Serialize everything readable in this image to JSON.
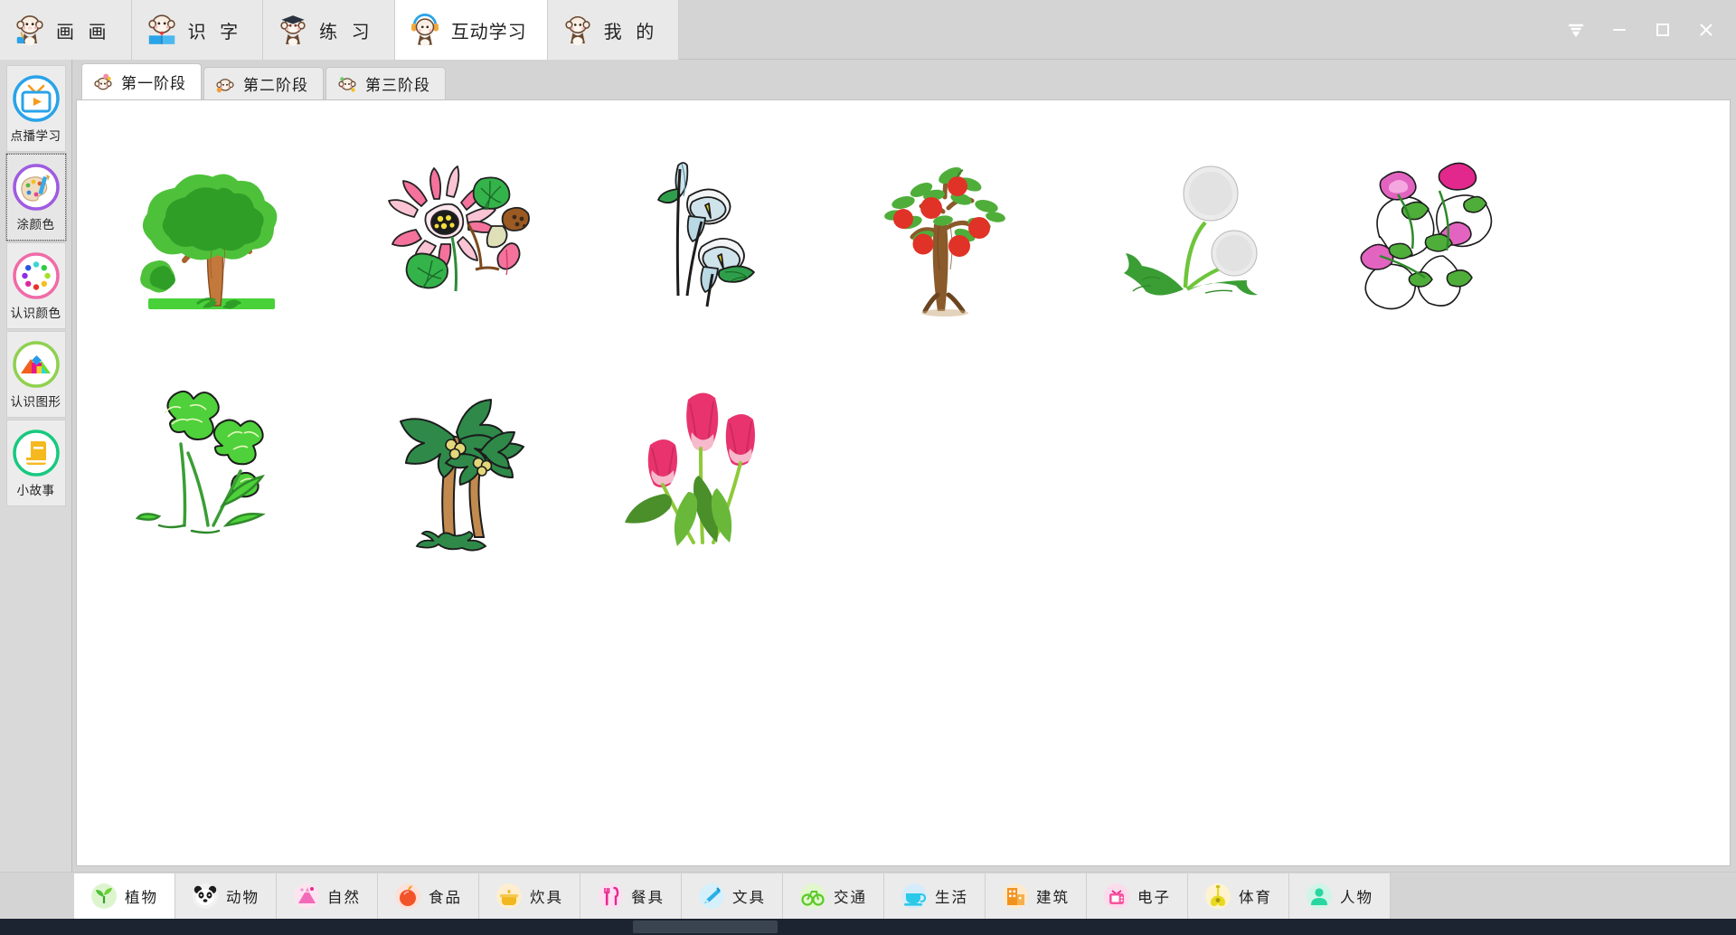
{
  "window": {
    "controls": [
      {
        "name": "collapse",
        "glyph": "chevron-down-icon"
      },
      {
        "name": "minimize",
        "glyph": "minimize-icon"
      },
      {
        "name": "maximize",
        "glyph": "maximize-icon"
      },
      {
        "name": "close",
        "glyph": "close-icon"
      }
    ]
  },
  "top_tabs": [
    {
      "label": "画 画",
      "icon": "monkey-painter-icon",
      "active": false
    },
    {
      "label": "识 字",
      "icon": "monkey-reader-icon",
      "active": false
    },
    {
      "label": "练 习",
      "icon": "monkey-graduate-icon",
      "active": false
    },
    {
      "label": "互动学习",
      "icon": "monkey-headphone-icon",
      "active": true
    },
    {
      "label": "我 的",
      "icon": "monkey-plain-icon",
      "active": false
    }
  ],
  "sidebar": {
    "items": [
      {
        "label": "点播学习",
        "icon": "tv-play-icon",
        "color": "#2aa3e8",
        "selected": false
      },
      {
        "label": "涂颜色",
        "icon": "palette-brush-icon",
        "color": "#a05be0",
        "selected": true
      },
      {
        "label": "认识颜色",
        "icon": "color-wheel-icon",
        "color": "#f06ba8",
        "selected": false
      },
      {
        "label": "认识图形",
        "icon": "shapes-mountain-icon",
        "color": "#8fd14f",
        "selected": false
      },
      {
        "label": "小故事",
        "icon": "book-icon",
        "color": "#18c97f",
        "selected": false
      }
    ]
  },
  "stage_tabs": [
    {
      "label": "第一阶段",
      "icon": "monkey-stage1-icon",
      "active": true
    },
    {
      "label": "第二阶段",
      "icon": "monkey-stage2-icon",
      "active": false
    },
    {
      "label": "第三阶段",
      "icon": "monkey-stage3-icon",
      "active": false
    }
  ],
  "gallery": {
    "items": [
      {
        "name": "tree",
        "label": "大树"
      },
      {
        "name": "lotus",
        "label": "荷花"
      },
      {
        "name": "calla-lily",
        "label": "马蹄莲"
      },
      {
        "name": "apple-tree",
        "label": "苹果树"
      },
      {
        "name": "dandelion",
        "label": "蒲公英"
      },
      {
        "name": "morning-glory",
        "label": "牵牛花"
      },
      {
        "name": "clover",
        "label": "三叶草"
      },
      {
        "name": "palm-tree",
        "label": "椰子树"
      },
      {
        "name": "tulip",
        "label": "郁金香"
      }
    ]
  },
  "categories": [
    {
      "label": "植物",
      "icon": "sprout-icon",
      "active": true
    },
    {
      "label": "动物",
      "icon": "panda-icon",
      "active": false
    },
    {
      "label": "自然",
      "icon": "volcano-icon",
      "active": false
    },
    {
      "label": "食品",
      "icon": "apple-icon",
      "active": false
    },
    {
      "label": "炊具",
      "icon": "pot-icon",
      "active": false
    },
    {
      "label": "餐具",
      "icon": "cutlery-icon",
      "active": false
    },
    {
      "label": "文具",
      "icon": "pen-icon",
      "active": false
    },
    {
      "label": "交通",
      "icon": "bicycle-icon",
      "active": false
    },
    {
      "label": "生活",
      "icon": "cup-icon",
      "active": false
    },
    {
      "label": "建筑",
      "icon": "building-icon",
      "active": false
    },
    {
      "label": "电子",
      "icon": "tv-icon",
      "active": false
    },
    {
      "label": "体育",
      "icon": "guitar-icon",
      "active": false
    },
    {
      "label": "人物",
      "icon": "person-icon",
      "active": false
    }
  ]
}
